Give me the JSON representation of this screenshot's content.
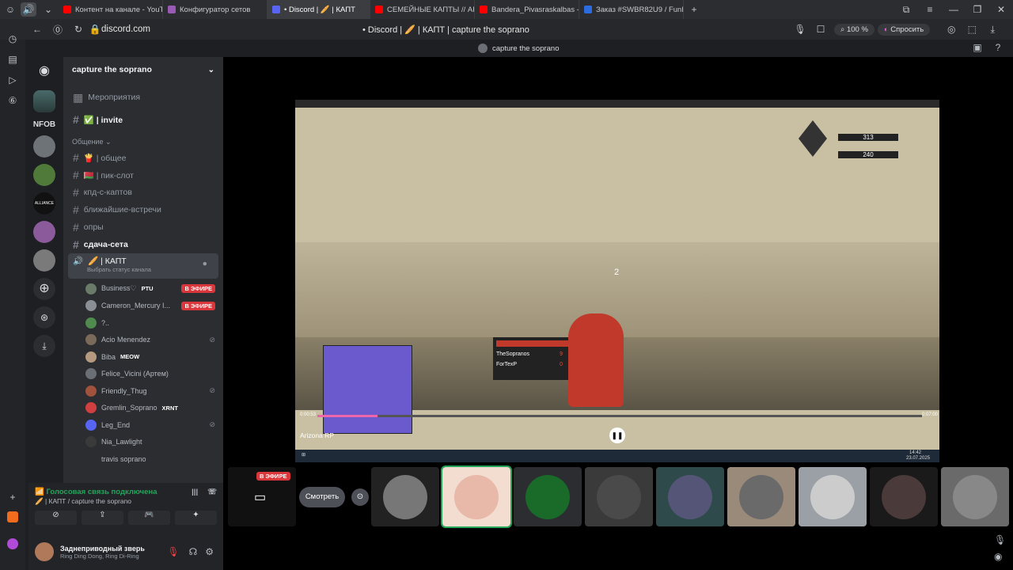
{
  "browser": {
    "tabs": [
      {
        "label": "Контент на канале - YouTu",
        "color": "#ff0000"
      },
      {
        "label": "Конфигуратор сетов",
        "color": "#9b59b6"
      },
      {
        "label": "• Discord | 🥖 | КАПТ",
        "color": "#5865f2",
        "active": true
      },
      {
        "label": "СЕМЕЙНЫЕ КАПТЫ // AR",
        "color": "#ff0000"
      },
      {
        "label": "Bandera_Pivasraskalbas -",
        "color": "#ff0000"
      },
      {
        "label": "Заказ #SWBR82U9 / FunP",
        "color": "#2d6cdf"
      }
    ],
    "url": "discord.com",
    "page_title": "• Discord | 🥖 | КАПТ | capture the soprano",
    "zoom": "100 %",
    "ask_label": "Спросить"
  },
  "discord": {
    "stage_title": "capture the soprano",
    "server_name": "capture the soprano",
    "nfob_label": "NFOB",
    "events_label": "Мероприятия",
    "channels_top": [
      {
        "name": "✅ | invite",
        "bold": true
      }
    ],
    "category": "Общение",
    "channels": [
      {
        "name": "🍟 | общее"
      },
      {
        "name": "🇧🇾 | пик-слот"
      },
      {
        "name": "кпд-с-каптов"
      },
      {
        "name": "ближайшие-встречи"
      },
      {
        "name": "опры"
      },
      {
        "name": "сдача-сета",
        "bold": true
      }
    ],
    "voice_channel": {
      "name": "🥖 | КАПТ",
      "status": "Выбрать статус канала"
    },
    "voice_users": [
      {
        "name": "Business♡",
        "tag": "PTU",
        "live": "В ЭФИРЕ",
        "color": "#6a7b6a"
      },
      {
        "name": "Cameron_Mercury I...",
        "live": "В ЭФИРЕ",
        "color": "#8a8f95"
      },
      {
        "name": "?..",
        "color": "#4f8a4f"
      },
      {
        "name": "Acio Menendez",
        "muted": true,
        "color": "#7a6a5a"
      },
      {
        "name": "Biba",
        "tag": "MEOW",
        "color": "#b59a80"
      },
      {
        "name": "Felice_Vicini (Артем)",
        "color": "#6a6f75"
      },
      {
        "name": "Friendly_Thug",
        "muted": true,
        "color": "#a0523c"
      },
      {
        "name": "Gremlin_Soprano",
        "tag": "XRNT",
        "color": "#d04040"
      },
      {
        "name": "Leg_End",
        "muted": true,
        "color": "#5865f2"
      },
      {
        "name": "Nia_Lawlight",
        "color": "#3a3a3a"
      },
      {
        "name": "travis soprano",
        "color": "#2b2d31"
      }
    ],
    "voice_connected": "Голосовая связь подключена",
    "voice_location": "🥖 | КАПТ / capture the soprano",
    "user_name": "Заднеприводный зверь",
    "user_status": "Ring Ding Dong, Ring Di-Ring",
    "stream_live": "В ЭФИРЕ",
    "watch_label": "Смотреть",
    "video_source": "Arizona RP",
    "time_start": "0:00:53",
    "time_end": "0:07:00",
    "progress": 0.1,
    "hud": {
      "health": "313",
      "armor": "240",
      "countdown": "2"
    },
    "scoreboard": {
      "player1": "TheSopranos",
      "score1": "9",
      "player2": "ForTexP",
      "score2": "0"
    },
    "taskbar_time": "14:42",
    "taskbar_date": "23.07.2025"
  }
}
